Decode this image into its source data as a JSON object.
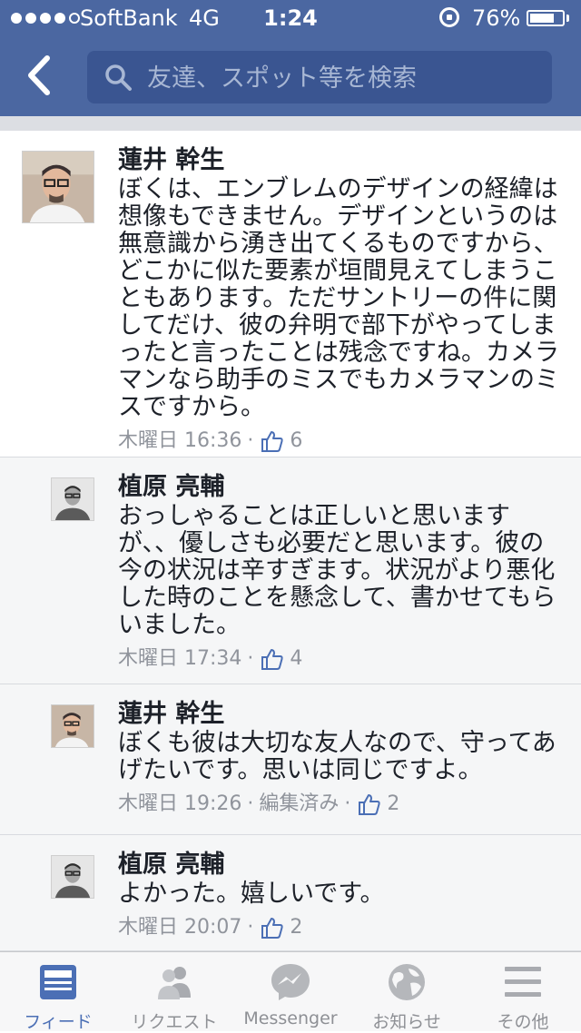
{
  "status_bar": {
    "carrier": "SoftBank",
    "network": "4G",
    "time": "1:24",
    "battery_percent": "76%",
    "battery_level": 0.76
  },
  "header": {
    "back_icon": "chevron-left-icon",
    "search_placeholder": "友達、スポット等を検索",
    "colors": {
      "bar": "#4b67a1",
      "search": "#3a5591"
    }
  },
  "comments": [
    {
      "name": "蓮井 幹生",
      "text": "ぼくは、エンブレムのデザインの経緯は想像もできません。デザインというのは無意識から湧き出てくるものですから、どこかに似た要素が垣間見えてしまうこともあります。ただサントリーの件に関してだけ、彼の弁明で部下がやってしまったと言ったことは残念ですね。カメラマンなら助手のミスでもカメラマンのミスですから。",
      "time": "木曜日 16:36",
      "likes": "6"
    },
    {
      "name": "植原 亮輔",
      "text": "おっしゃることは正しいと思いますが、、優しさも必要だと思います。彼の今の状況は辛すぎます。状況がより悪化した時のことを懸念して、書かせてもらいました。",
      "time": "木曜日 17:34",
      "likes": "4"
    },
    {
      "name": "蓮井 幹生",
      "text": "ぼくも彼は大切な友人なので、守ってあげたいです。思いは同じですよ。",
      "time": "木曜日 19:26",
      "edited": "編集済み",
      "likes": "2"
    },
    {
      "name": "植原 亮輔",
      "text": "よかった。嬉しいです。",
      "time": "木曜日 20:07",
      "likes": "2"
    }
  ],
  "tabs": [
    {
      "label": "フィード",
      "icon": "news-feed-icon",
      "active": true
    },
    {
      "label": "リクエスト",
      "icon": "friend-requests-icon"
    },
    {
      "label": "Messenger",
      "icon": "messenger-icon"
    },
    {
      "label": "お知らせ",
      "icon": "globe-icon"
    },
    {
      "label": "その他",
      "icon": "menu-icon"
    }
  ],
  "colors": {
    "active_tab": "#4b6fb5",
    "inactive_tab": "#8e9095"
  }
}
